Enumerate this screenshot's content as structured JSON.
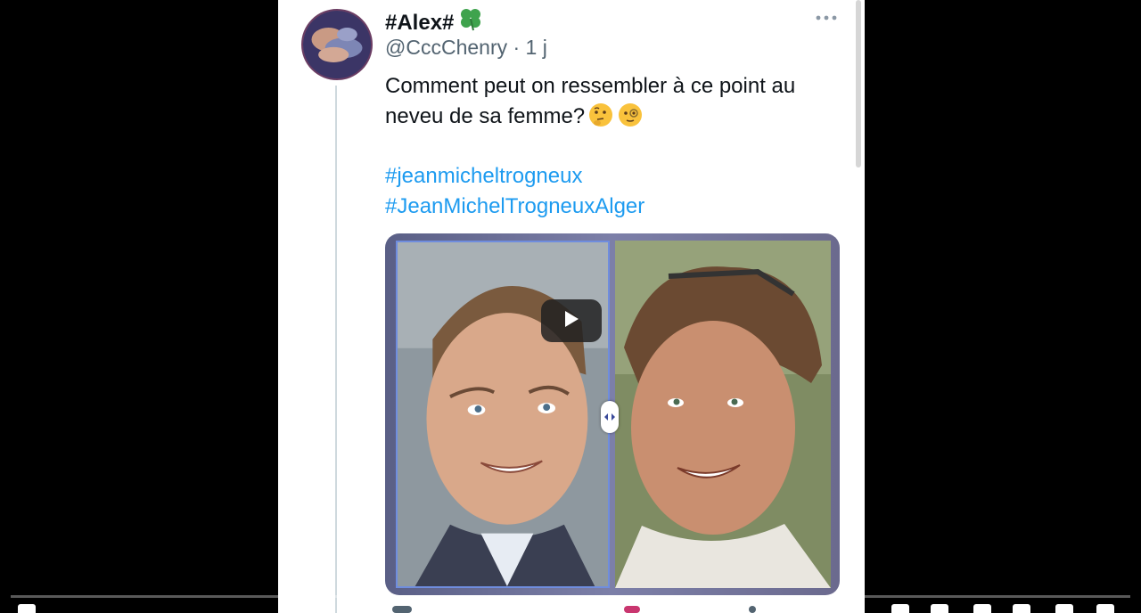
{
  "tweet": {
    "display_name": "#Alex#",
    "handle": "@CccChenry",
    "time": "· 1 j",
    "text": "Comment peut on ressembler à ce point au neveu de sa femme?",
    "emojis": [
      "thinking-face",
      "face-with-monocle"
    ],
    "hashtags": [
      "#jeanmicheltrogneux",
      "#JeanMichelTrogneuxAlger"
    ]
  },
  "colors": {
    "link": "#1d9bf0",
    "text": "#0f1419",
    "secondary": "#536471",
    "player_bg": "#000000",
    "progress": "#ff0000"
  },
  "player": {
    "progress_fraction": 0
  },
  "icons": {
    "verified_emoji": "four-leaf-clover",
    "more": "more-dots-icon",
    "play": "play-icon",
    "compare": "compare-arrows-icon"
  }
}
